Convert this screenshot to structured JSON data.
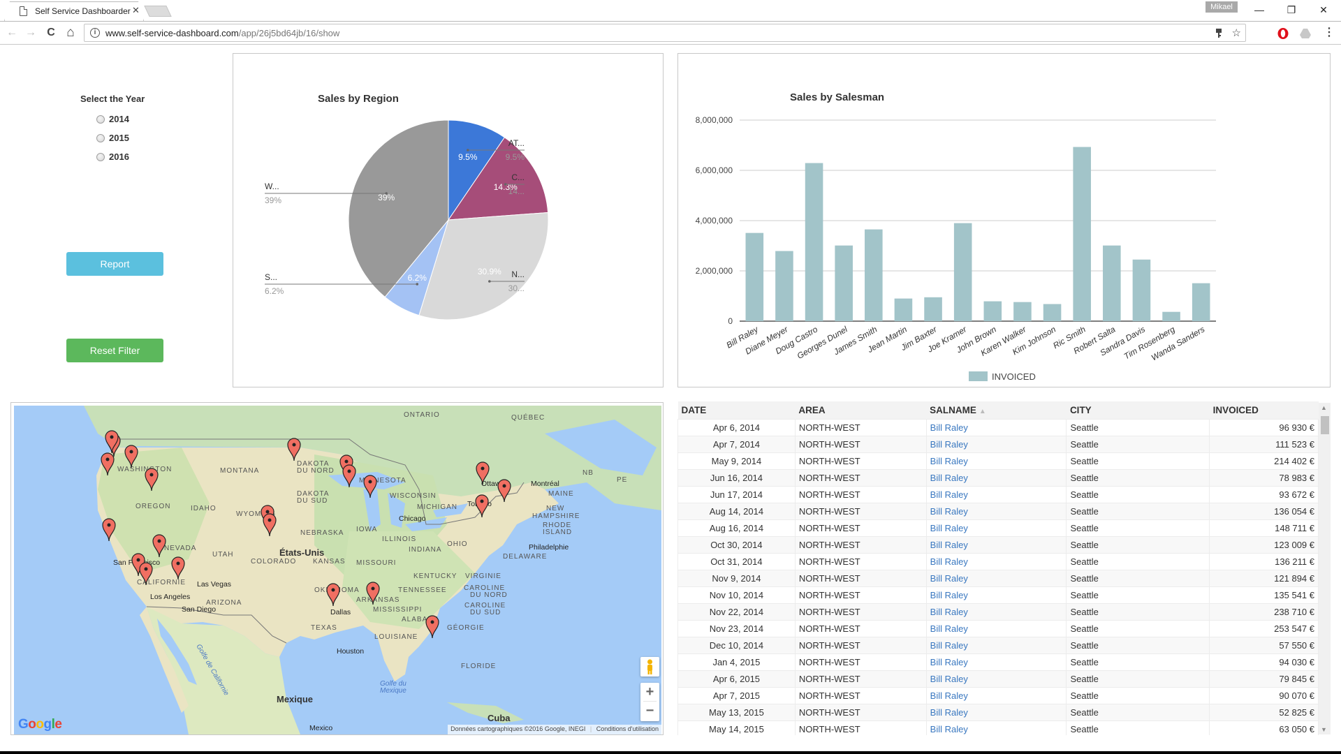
{
  "browser": {
    "tab_title": "Self Service Dashboarder",
    "tab_close": "✕",
    "profile": "Mikael",
    "url_host": "www.self-service-dashboard.com",
    "url_path": "/app/26j5bd64jb/16/show",
    "window_controls": {
      "minimize": "—",
      "restore": "❐",
      "close": "✕"
    },
    "nav": {
      "back": "←",
      "forward": "→",
      "reload": "C",
      "home": "⌂"
    },
    "omni_icons": {
      "key": "key-icon",
      "star": "☆"
    },
    "menu": "⋮"
  },
  "filter": {
    "title": "Select the Year",
    "years": [
      "2014",
      "2015",
      "2016"
    ],
    "report_label": "Report",
    "reset_label": "Reset Filter",
    "report_color": "#5bc0de",
    "reset_color": "#5cb85c"
  },
  "chart_data": [
    {
      "type": "pie",
      "title": "Sales by Region",
      "slices": [
        {
          "label": "AT...",
          "value": 9.5,
          "display": "9.5%",
          "legend_value": "9.5%",
          "color": "#3c78d8"
        },
        {
          "label": "C...",
          "value": 14.3,
          "display": "14.3%",
          "legend_value": "14...",
          "color": "#a64d79"
        },
        {
          "label": "N...",
          "value": 30.9,
          "display": "30.9%",
          "legend_value": "30...",
          "color": "#d9d9d9"
        },
        {
          "label": "S...",
          "value": 6.2,
          "display": "6.2%",
          "legend_value": "6.2%",
          "color": "#a4c2f4"
        },
        {
          "label": "W...",
          "value": 39.0,
          "display": "39%",
          "legend_value": "39%",
          "color": "#999999"
        }
      ]
    },
    {
      "type": "bar",
      "title": "Sales by Salesman",
      "categories": [
        "Bill Raley",
        "Diane Meyer",
        "Doug Castro",
        "Georges Dunel",
        "James Smith",
        "Jean Martin",
        "Jim Baxter",
        "Joe Kramer",
        "John Brown",
        "Karen Walker",
        "Kim Johnson",
        "Ric Smith",
        "Robert Salta",
        "Sandra Davis",
        "Tim Rosenberg",
        "Wanda Sanders"
      ],
      "series": [
        {
          "name": "INVOICED",
          "color": "#a2c4c9",
          "values": [
            3510000,
            2790000,
            6290000,
            3010000,
            3650000,
            900000,
            950000,
            3900000,
            790000,
            760000,
            680000,
            6930000,
            3010000,
            2450000,
            370000,
            1510000
          ]
        }
      ],
      "yticks": [
        "0",
        "2,000,000",
        "4,000,000",
        "6,000,000",
        "8,000,000"
      ],
      "ylim": [
        0,
        8000000
      ],
      "xlabel": "",
      "ylabel": "",
      "grid": true,
      "legend": "bottom"
    }
  ],
  "map": {
    "region_labels": [
      "ONTARIO",
      "QUÉBEC",
      "MONTANA",
      "DAKOTA",
      "DU NORD",
      "DAKOTA",
      "DU SUD",
      "OREGON",
      "IDAHO",
      "WYOMING",
      "NEBRASKA",
      "NEVADA",
      "UTAH",
      "COLORADO",
      "KANSAS",
      "CALIFORNIE",
      "ARIZONA",
      "OKLAHOMA",
      "TEXAS",
      "MINNESOTA",
      "WISCONSIN",
      "MICHIGAN",
      "IOWA",
      "ILLINOIS",
      "INDIANA",
      "OHIO",
      "MISSOURI",
      "KENTUCKY",
      "VIRGINIE",
      "TENNESSEE",
      "ARKANSAS",
      "MISSISSIPPI",
      "ALABAMA",
      "CAROLINE",
      "DU NORD",
      "CAROLINE",
      "DU SUD",
      "GÉORGIE",
      "LOUISIANE",
      "FLORIDE",
      "NEW",
      "HAMPSHIRE",
      "RHODE",
      "ISLAND",
      "DELAWARE",
      "MAINE",
      "NB",
      "PE",
      "WASHINGTON"
    ],
    "cities": [
      "San Francisco",
      "Las Vegas",
      "Los Angeles",
      "San Diego",
      "Dallas",
      "Houston",
      "Chicago",
      "Toronto",
      "Ottawa",
      "Montréal",
      "Philadelphie",
      "Mexico"
    ],
    "countries": [
      "États-Unis",
      "Mexique",
      "Cuba"
    ],
    "waters": [
      "Golfe du",
      "Mexique",
      "Golfe de Californie"
    ],
    "attribution": "Données cartographiques ©2016 Google, INEGI",
    "terms": "Conditions d'utilisation",
    "logo": "Google",
    "zoom_in": "+",
    "zoom_out": "−",
    "marker_color": "#f06f62"
  },
  "table": {
    "columns": [
      "DATE",
      "AREA",
      "SALNAME",
      "CITY",
      "INVOICED"
    ],
    "sort_column": "SALNAME",
    "sort_indicator": "▲",
    "rows": [
      [
        "Apr 6, 2014",
        "NORTH-WEST",
        "Bill Raley",
        "Seattle",
        "96 930 €"
      ],
      [
        "Apr 7, 2014",
        "NORTH-WEST",
        "Bill Raley",
        "Seattle",
        "111 523 €"
      ],
      [
        "May 9, 2014",
        "NORTH-WEST",
        "Bill Raley",
        "Seattle",
        "214 402 €"
      ],
      [
        "Jun 16, 2014",
        "NORTH-WEST",
        "Bill Raley",
        "Seattle",
        "78 983 €"
      ],
      [
        "Jun 17, 2014",
        "NORTH-WEST",
        "Bill Raley",
        "Seattle",
        "93 672 €"
      ],
      [
        "Aug 14, 2014",
        "NORTH-WEST",
        "Bill Raley",
        "Seattle",
        "136 054 €"
      ],
      [
        "Aug 16, 2014",
        "NORTH-WEST",
        "Bill Raley",
        "Seattle",
        "148 711 €"
      ],
      [
        "Oct 30, 2014",
        "NORTH-WEST",
        "Bill Raley",
        "Seattle",
        "123 009 €"
      ],
      [
        "Oct 31, 2014",
        "NORTH-WEST",
        "Bill Raley",
        "Seattle",
        "136 211 €"
      ],
      [
        "Nov 9, 2014",
        "NORTH-WEST",
        "Bill Raley",
        "Seattle",
        "121 894 €"
      ],
      [
        "Nov 10, 2014",
        "NORTH-WEST",
        "Bill Raley",
        "Seattle",
        "135 541 €"
      ],
      [
        "Nov 22, 2014",
        "NORTH-WEST",
        "Bill Raley",
        "Seattle",
        "238 710 €"
      ],
      [
        "Nov 23, 2014",
        "NORTH-WEST",
        "Bill Raley",
        "Seattle",
        "253 547 €"
      ],
      [
        "Dec 10, 2014",
        "NORTH-WEST",
        "Bill Raley",
        "Seattle",
        "57 550 €"
      ],
      [
        "Jan 4, 2015",
        "NORTH-WEST",
        "Bill Raley",
        "Seattle",
        "94 030 €"
      ],
      [
        "Apr 6, 2015",
        "NORTH-WEST",
        "Bill Raley",
        "Seattle",
        "79 845 €"
      ],
      [
        "Apr 7, 2015",
        "NORTH-WEST",
        "Bill Raley",
        "Seattle",
        "90 070 €"
      ],
      [
        "May 13, 2015",
        "NORTH-WEST",
        "Bill Raley",
        "Seattle",
        "52 825 €"
      ],
      [
        "May 14, 2015",
        "NORTH-WEST",
        "Bill Raley",
        "Seattle",
        "63 050 €"
      ]
    ]
  }
}
